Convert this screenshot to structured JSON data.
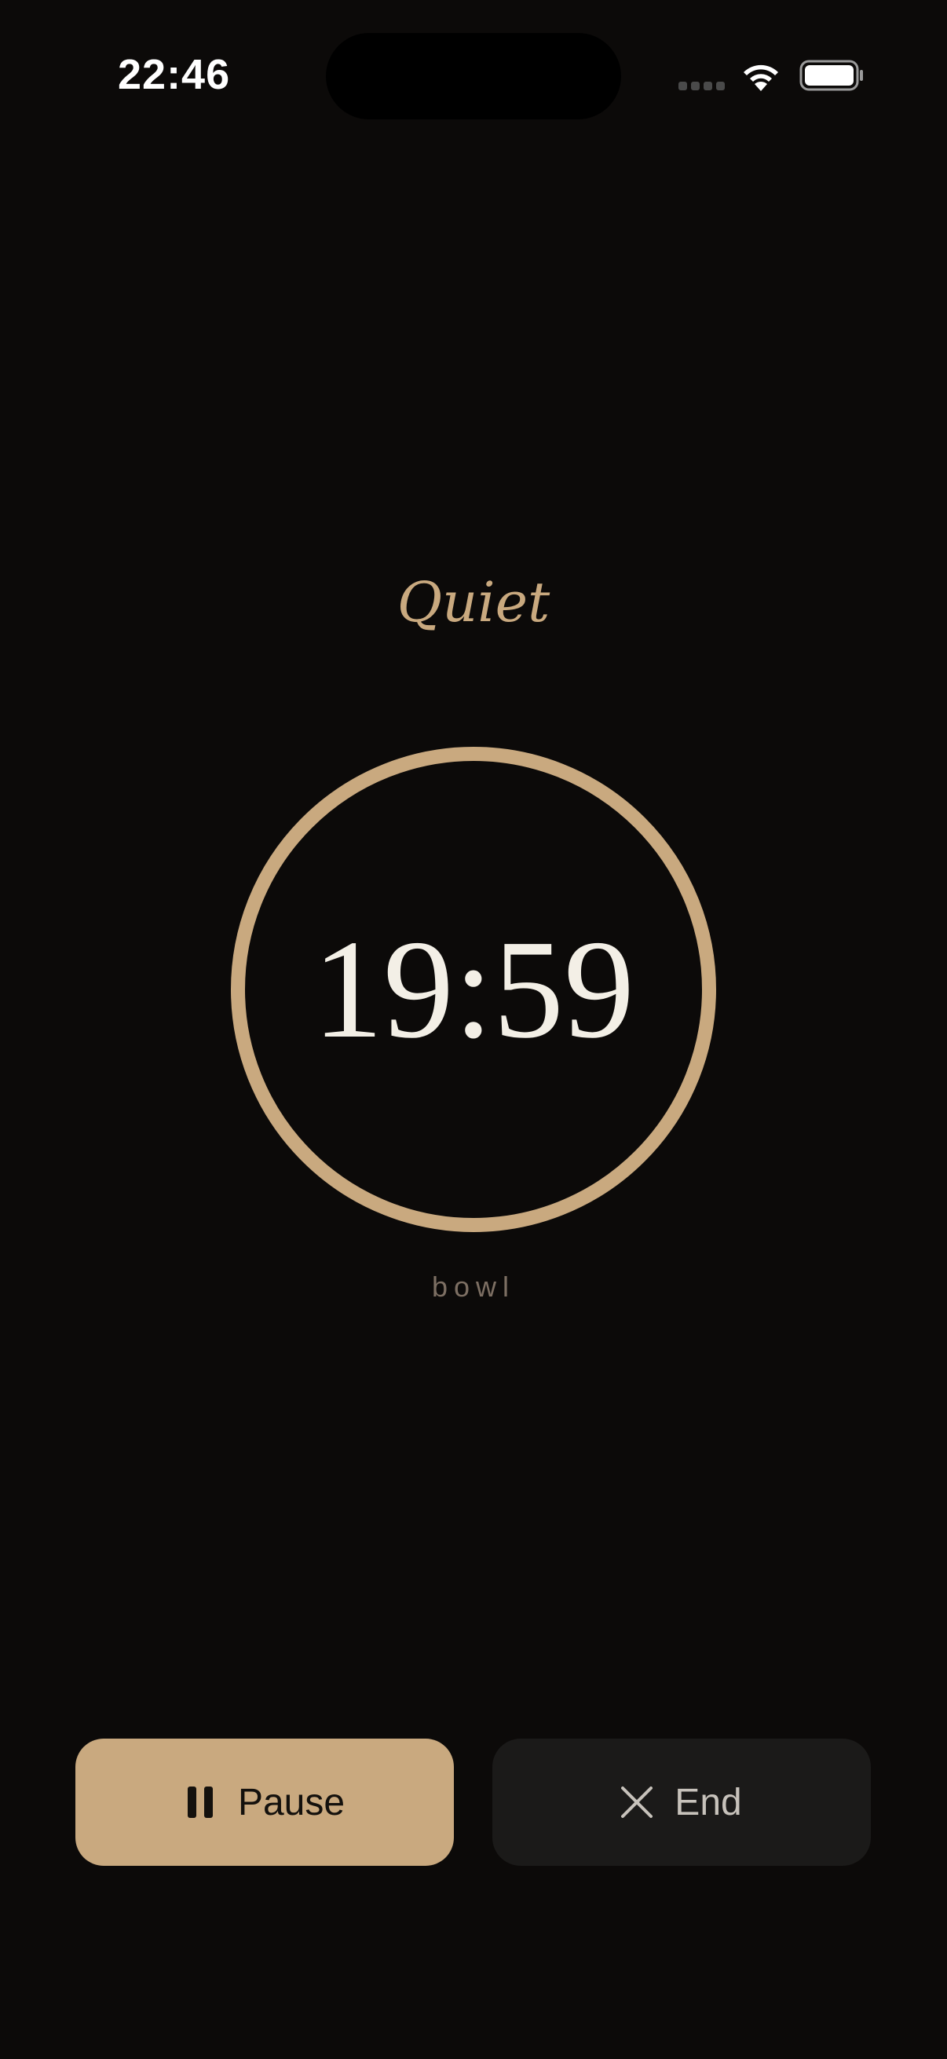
{
  "status_bar": {
    "time": "22:46",
    "icons": [
      "cellular-signal-icon",
      "wifi-icon",
      "battery-icon"
    ]
  },
  "session": {
    "name": "Quiet",
    "remaining_time": "19:59",
    "sound_label": "bowl"
  },
  "controls": {
    "pause_label": "Pause",
    "pause_icon": "pause-icon",
    "end_label": "End",
    "end_icon": "close-icon"
  },
  "colors": {
    "background": "#0c0a09",
    "accent": "#c9a97f",
    "timer_text": "#f3efe6",
    "secondary_text": "#7d6f63",
    "end_button_bg": "#1b1a19"
  }
}
